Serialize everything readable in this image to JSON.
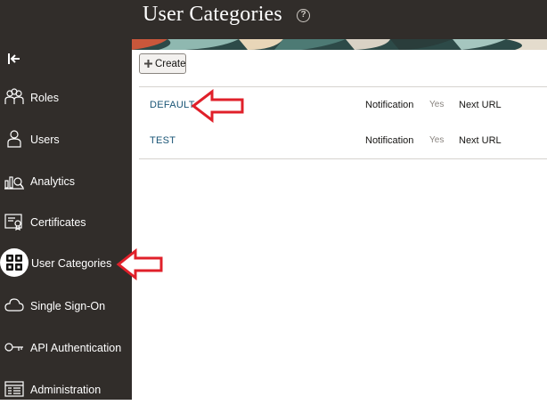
{
  "header": {
    "title": "User Categories",
    "help_icon": "question-circle-icon"
  },
  "sidebar": {
    "collapse_icon": "collapse-left-icon",
    "items": [
      {
        "label": "Roles",
        "icon": "roles-icon",
        "active": false
      },
      {
        "label": "Users",
        "icon": "user-icon",
        "active": false
      },
      {
        "label": "Analytics",
        "icon": "analytics-icon",
        "active": false
      },
      {
        "label": "Certificates",
        "icon": "certificate-icon",
        "active": false
      },
      {
        "label": "User Categories",
        "icon": "grid-icon",
        "active": true
      },
      {
        "label": "Single Sign-On",
        "icon": "cloud-icon",
        "active": false
      },
      {
        "label": "API Authentication",
        "icon": "key-icon",
        "active": false
      },
      {
        "label": "Administration",
        "icon": "admin-icon",
        "active": false
      }
    ]
  },
  "toolbar": {
    "create_label": "Create"
  },
  "categories": [
    {
      "name": "DEFAULT",
      "notification_label": "Notification",
      "notification_value": "Yes",
      "next_url_label": "Next URL"
    },
    {
      "name": "TEST",
      "notification_label": "Notification",
      "notification_value": "Yes",
      "next_url_label": "Next URL"
    }
  ],
  "colors": {
    "sidebar_bg": "#312d2a",
    "link": "#1a5576",
    "annotation_arrow": "#e0202a"
  }
}
